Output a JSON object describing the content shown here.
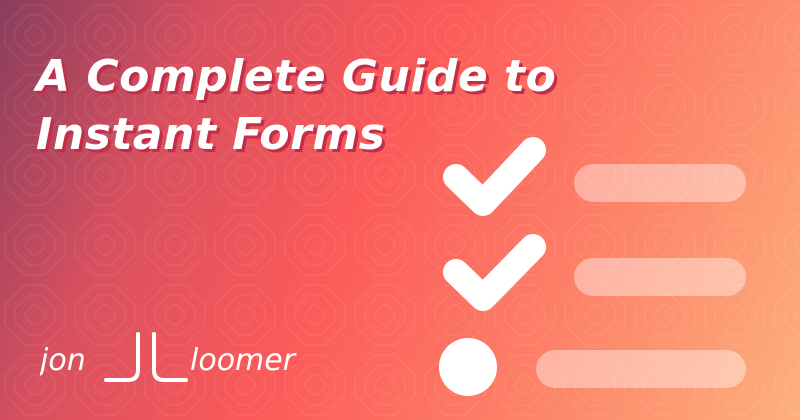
{
  "title": {
    "line1": "A Complete Guide to",
    "line2": "Instant Forms"
  },
  "brand": {
    "first": "jon",
    "last": "loomer"
  },
  "checklist": {
    "items": [
      {
        "state": "checked"
      },
      {
        "state": "checked"
      },
      {
        "state": "unchecked"
      }
    ]
  },
  "icons": {
    "checkmark": "checkmark-icon",
    "bullet": "circle-bullet-icon"
  },
  "colors": {
    "gradient_start": "#8a3d5e",
    "gradient_mid": "#fb5a59",
    "gradient_end": "#fdb07d",
    "title_shadow": "#c42d47",
    "foreground": "#ffffff"
  }
}
